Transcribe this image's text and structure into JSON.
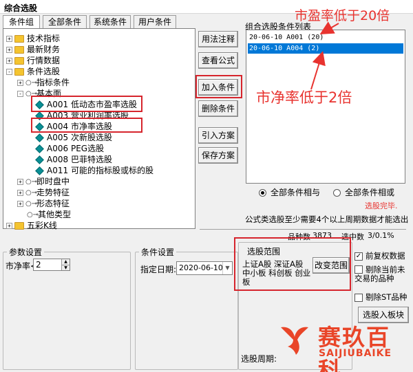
{
  "window": {
    "title": "综合选股"
  },
  "tabs": [
    "条件组",
    "全部条件",
    "系统条件",
    "用户条件"
  ],
  "tree": {
    "folders": [
      {
        "label": "技术指标",
        "expander": "+"
      },
      {
        "label": "最新财务",
        "expander": "+"
      },
      {
        "label": "行情数据",
        "expander": "+"
      },
      {
        "label": "条件选股",
        "expander": "-"
      }
    ],
    "conditions_children": [
      {
        "label": "指标条件",
        "expander": "+"
      },
      {
        "label": "基本面",
        "expander": "-"
      }
    ],
    "fundamentals": [
      {
        "code": "A001",
        "name": "低动态市盈率选股"
      },
      {
        "code": "A003",
        "name": "营业利润率选股"
      },
      {
        "code": "A004",
        "name": "市净率选股"
      },
      {
        "code": "A005",
        "name": "次新股选股"
      },
      {
        "code": "A006",
        "name": "PEG选股"
      },
      {
        "code": "A008",
        "name": "巴菲特选股"
      },
      {
        "code": "A011",
        "name": "可能的指标股或标的股"
      }
    ],
    "others": [
      {
        "label": "即时盘中",
        "expander": "+"
      },
      {
        "label": "走势特征",
        "expander": "+"
      },
      {
        "label": "形态特征",
        "expander": "+"
      },
      {
        "label": "其他类型",
        "expander": ""
      }
    ],
    "wucai": {
      "label": "五彩K线",
      "expander": "+"
    }
  },
  "buttons": {
    "usage": "用法注释",
    "view_formula": "查看公式",
    "add_condition": "加入条件",
    "delete_condition": "删除条件",
    "import_plan": "引入方案",
    "save_plan": "保存方案"
  },
  "condition_list": {
    "label": "组合选股条件列表",
    "items": [
      {
        "text": "20-06-10 A001 (20)",
        "selected": false
      },
      {
        "text": "20-06-10 A004 (2)",
        "selected": true
      }
    ]
  },
  "annotations": {
    "pe": "市盈率低于20倍",
    "pb": "市净率低于2倍"
  },
  "logic": {
    "and_label": "全部条件相与",
    "or_label": "全部条件相或",
    "selected": "and"
  },
  "status": {
    "done": "选股完毕.",
    "formula_note": "公式类选股至少需要4个以上周期数据才能选出",
    "stock_count_label": "品种数",
    "stock_count": "3873",
    "selected_label": "选中数",
    "selected_value": "3/0.1%"
  },
  "params": {
    "group_label": "参数设置",
    "field_label": "市净率<",
    "field_value": "2"
  },
  "cond_settings": {
    "group_label": "条件设置",
    "date_label": "指定日期:",
    "date_value": "2020-06-10"
  },
  "range": {
    "group_label": "选股范围",
    "text": "上证A股 深证A股 中小板 科创板 创业板",
    "change_button": "改变范围"
  },
  "options": {
    "fq": {
      "label": "前复权数据",
      "checked": true
    },
    "exclude_halt": {
      "label": "剔除当前未交易的品种",
      "checked": false
    },
    "exclude_st": {
      "label": "剔除ST品种",
      "checked": false
    },
    "to_block": "选股入板块"
  },
  "period": {
    "label": "选股周期:"
  },
  "logo": {
    "cn": "赛玖百科",
    "en": "SAIJIUBAIKE"
  },
  "colors": {
    "annotation_red": "#e8332f",
    "selection_blue": "#0078d7",
    "logo_orange": "#e94528"
  }
}
